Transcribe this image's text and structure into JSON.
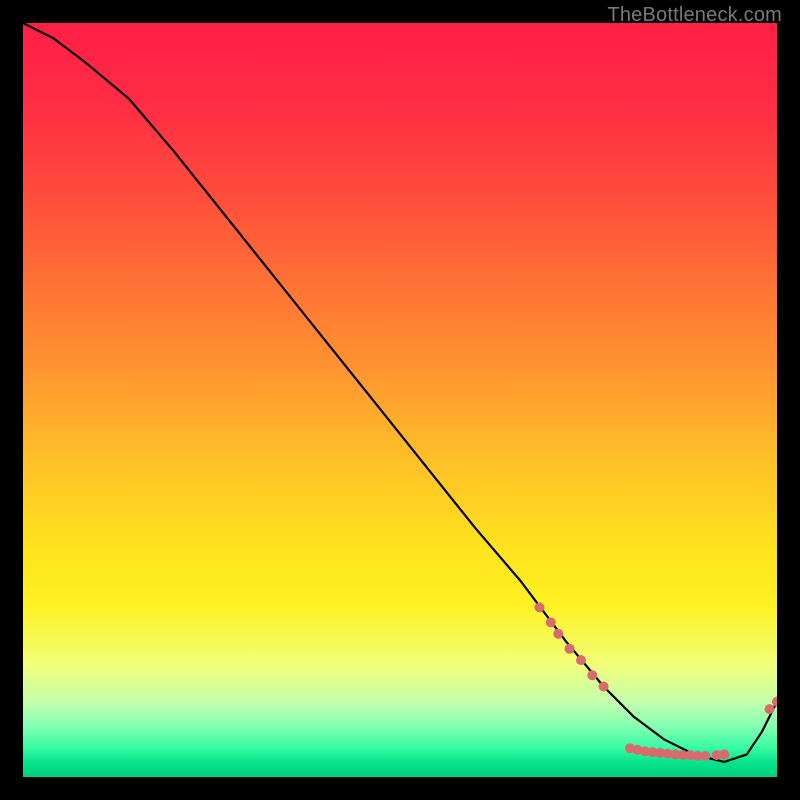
{
  "watermark": "TheBottleneck.com",
  "chart_data": {
    "type": "line",
    "title": "",
    "xlabel": "",
    "ylabel": "",
    "xlim": [
      0,
      100
    ],
    "ylim": [
      0,
      100
    ],
    "grid": false,
    "series": [
      {
        "name": "curve",
        "x": [
          0,
          4,
          8,
          14,
          20,
          28,
          36,
          44,
          52,
          60,
          66,
          72,
          77,
          81,
          85,
          89,
          93,
          96,
          98,
          100
        ],
        "y": [
          100,
          98,
          95,
          90,
          83,
          73,
          63,
          53,
          43,
          33,
          26,
          18,
          12,
          8,
          5,
          3,
          2,
          3,
          6,
          10
        ],
        "color": "#000000"
      }
    ],
    "markers": [
      {
        "name": "highlight-dots",
        "color": "#d86b6b",
        "radius": 5,
        "points": [
          {
            "x": 68.5,
            "y": 22.5
          },
          {
            "x": 70.0,
            "y": 20.5
          },
          {
            "x": 71.0,
            "y": 19.0
          },
          {
            "x": 72.5,
            "y": 17.0
          },
          {
            "x": 74.0,
            "y": 15.5
          },
          {
            "x": 75.5,
            "y": 13.5
          },
          {
            "x": 77.0,
            "y": 12.0
          },
          {
            "x": 80.5,
            "y": 3.8
          },
          {
            "x": 81.5,
            "y": 3.6
          },
          {
            "x": 82.5,
            "y": 3.4
          },
          {
            "x": 83.5,
            "y": 3.3
          },
          {
            "x": 84.5,
            "y": 3.2
          },
          {
            "x": 85.5,
            "y": 3.1
          },
          {
            "x": 86.5,
            "y": 3.0
          },
          {
            "x": 87.5,
            "y": 2.9
          },
          {
            "x": 88.5,
            "y": 2.9
          },
          {
            "x": 89.5,
            "y": 2.8
          },
          {
            "x": 90.5,
            "y": 2.8
          },
          {
            "x": 92.0,
            "y": 2.9
          },
          {
            "x": 93.0,
            "y": 3.0
          },
          {
            "x": 99.0,
            "y": 9.0
          },
          {
            "x": 100.0,
            "y": 10.0
          }
        ]
      }
    ],
    "gradient_stops": [
      {
        "pos": 0,
        "color": "#ff1f46"
      },
      {
        "pos": 10,
        "color": "#ff2b45"
      },
      {
        "pos": 22,
        "color": "#ff4a3d"
      },
      {
        "pos": 34,
        "color": "#ff7035"
      },
      {
        "pos": 46,
        "color": "#ff9530"
      },
      {
        "pos": 58,
        "color": "#ffc028"
      },
      {
        "pos": 70,
        "color": "#ffe41e"
      },
      {
        "pos": 77,
        "color": "#fff122"
      },
      {
        "pos": 85,
        "color": "#f1ff77"
      },
      {
        "pos": 90,
        "color": "#c4ffae"
      },
      {
        "pos": 93,
        "color": "#8affb3"
      },
      {
        "pos": 96,
        "color": "#3bfca5"
      },
      {
        "pos": 98,
        "color": "#07e58d"
      },
      {
        "pos": 100,
        "color": "#00cf7e"
      }
    ]
  }
}
